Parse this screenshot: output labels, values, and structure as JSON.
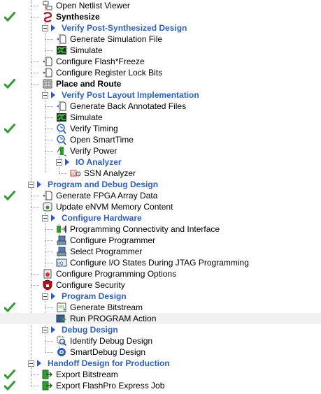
{
  "tree": {
    "items": [
      {
        "label": "Open Netlist Viewer",
        "icon": "netlist-viewer-icon",
        "done": false,
        "indent": 3,
        "style": "normal",
        "expander": false
      },
      {
        "label": "Synthesize",
        "icon": "synthesize-icon",
        "done": true,
        "indent": 3,
        "style": "bold",
        "expander": false
      },
      {
        "label": "Verify Post-Synthesized Design",
        "icon": "",
        "done": false,
        "indent": 3,
        "style": "category",
        "expander": true
      },
      {
        "label": "Generate Simulation File",
        "icon": "generate-file-icon",
        "done": false,
        "indent": 4,
        "style": "normal",
        "expander": false
      },
      {
        "label": "Simulate",
        "icon": "simulate-icon",
        "done": false,
        "indent": 4,
        "style": "normal",
        "expander": false
      },
      {
        "label": "Configure Flash*Freeze",
        "icon": "configure-file-icon",
        "done": false,
        "indent": 3,
        "style": "normal",
        "expander": false
      },
      {
        "label": "Configure Register Lock Bits",
        "icon": "configure-file-icon",
        "done": false,
        "indent": 3,
        "style": "normal",
        "expander": false
      },
      {
        "label": "Place and Route",
        "icon": "place-route-icon",
        "done": true,
        "indent": 3,
        "style": "bold",
        "expander": false
      },
      {
        "label": "Verify Post Layout Implementation",
        "icon": "",
        "done": false,
        "indent": 3,
        "style": "category",
        "expander": true
      },
      {
        "label": "Generate Back Annotated Files",
        "icon": "generate-file-icon",
        "done": false,
        "indent": 4,
        "style": "normal",
        "expander": false
      },
      {
        "label": "Simulate",
        "icon": "simulate-icon",
        "done": false,
        "indent": 4,
        "style": "normal",
        "expander": false
      },
      {
        "label": "Verify Timing",
        "icon": "timing-icon",
        "done": true,
        "indent": 4,
        "style": "normal",
        "expander": false
      },
      {
        "label": "Open SmartTime",
        "icon": "timing-icon",
        "done": false,
        "indent": 4,
        "style": "normal",
        "expander": false
      },
      {
        "label": "Verify Power",
        "icon": "power-icon",
        "done": false,
        "indent": 4,
        "style": "normal",
        "expander": false
      },
      {
        "label": "IO Analyzer",
        "icon": "",
        "done": false,
        "indent": 4,
        "style": "category",
        "expander": true
      },
      {
        "label": "SSN Analyzer",
        "icon": "ssn-analyzer-icon",
        "done": false,
        "indent": 5,
        "style": "normal",
        "expander": false
      },
      {
        "label": "Program and Debug Design",
        "icon": "",
        "done": false,
        "indent": 2,
        "style": "category",
        "expander": true
      },
      {
        "label": "Generate FPGA Array Data",
        "icon": "generate-file-icon",
        "done": true,
        "indent": 3,
        "style": "normal",
        "expander": false
      },
      {
        "label": "Update eNVM Memory Content",
        "icon": "memory-icon",
        "done": false,
        "indent": 3,
        "style": "normal",
        "expander": false
      },
      {
        "label": "Configure Hardware",
        "icon": "",
        "done": false,
        "indent": 3,
        "style": "category",
        "expander": true
      },
      {
        "label": "Programming Connectivity and Interface",
        "icon": "connectivity-icon",
        "done": false,
        "indent": 4,
        "style": "normal",
        "expander": false
      },
      {
        "label": "Configure Programmer",
        "icon": "programmer-icon",
        "done": false,
        "indent": 4,
        "style": "normal",
        "expander": false
      },
      {
        "label": "Select Programmer",
        "icon": "programmer-icon",
        "done": false,
        "indent": 4,
        "style": "normal",
        "expander": false
      },
      {
        "label": "Configure I/O States During JTAG Programming",
        "icon": "io-states-icon",
        "done": false,
        "indent": 4,
        "style": "normal",
        "expander": false
      },
      {
        "label": "Configure Programming Options",
        "icon": "options-icon",
        "done": false,
        "indent": 3,
        "style": "normal",
        "expander": false
      },
      {
        "label": "Configure Security",
        "icon": "security-icon",
        "done": false,
        "indent": 3,
        "style": "normal",
        "expander": false
      },
      {
        "label": "Program Design",
        "icon": "",
        "done": false,
        "indent": 3,
        "style": "category",
        "expander": true
      },
      {
        "label": "Generate Bitstream",
        "icon": "bitstream-icon",
        "done": true,
        "indent": 4,
        "style": "normal",
        "expander": false
      },
      {
        "label": "Run PROGRAM Action",
        "icon": "run-program-icon",
        "done": false,
        "indent": 4,
        "style": "normal",
        "expander": false
      },
      {
        "label": "Debug Design",
        "icon": "",
        "done": false,
        "indent": 3,
        "style": "category",
        "expander": true
      },
      {
        "label": "Identify Debug Design",
        "icon": "identify-icon",
        "done": false,
        "indent": 4,
        "style": "normal",
        "expander": false
      },
      {
        "label": "SmartDebug Design",
        "icon": "smartdebug-icon",
        "done": false,
        "indent": 4,
        "style": "normal",
        "expander": false
      },
      {
        "label": "Handoff Design for Production",
        "icon": "",
        "done": false,
        "indent": 2,
        "style": "category",
        "expander": true
      },
      {
        "label": "Export Bitstream",
        "icon": "export-icon",
        "done": true,
        "indent": 3,
        "style": "normal",
        "expander": false
      },
      {
        "label": "Export FlashPro Express Job",
        "icon": "export-icon",
        "done": true,
        "indent": 3,
        "style": "normal",
        "expander": false
      }
    ]
  },
  "colors": {
    "category": "#2b5fc9",
    "check": "#2e9d2e",
    "highlight": "#f0f0f0"
  }
}
